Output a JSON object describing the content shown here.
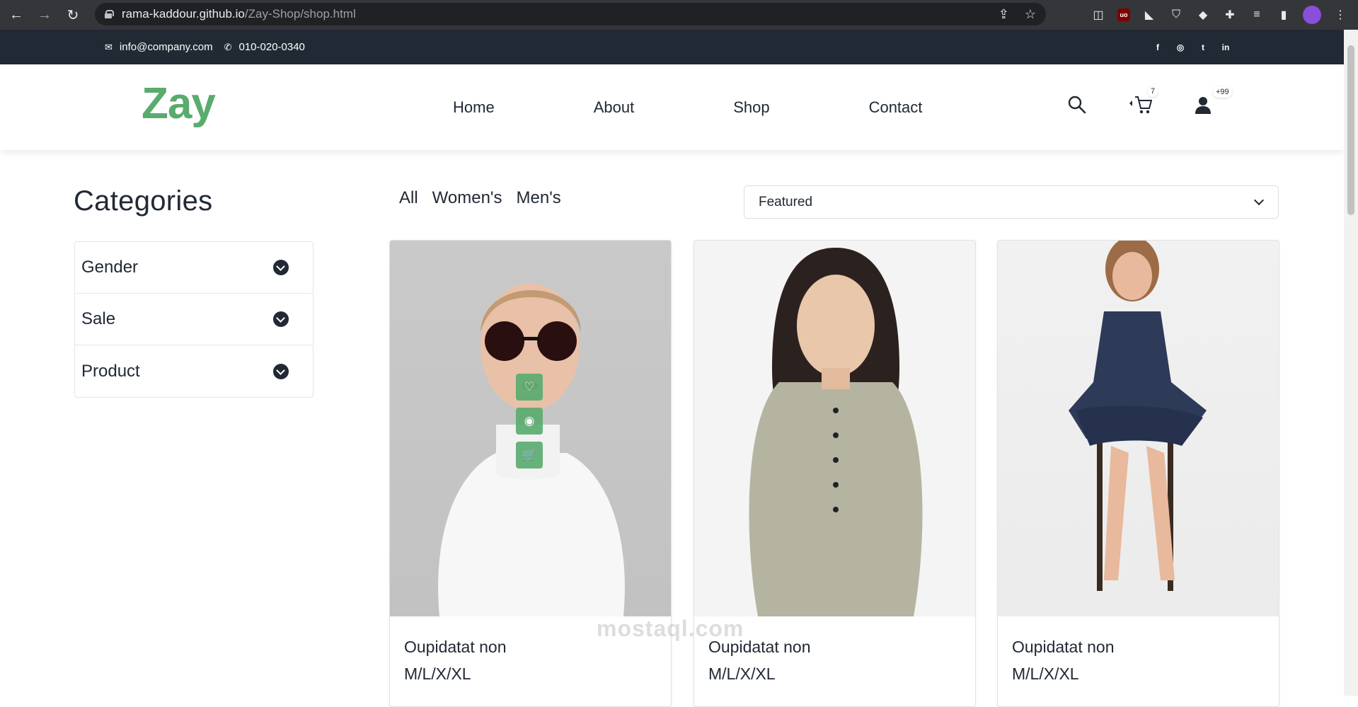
{
  "browser": {
    "url_host": "rama-kaddour.github.io",
    "url_path": "/Zay-Shop/shop.html"
  },
  "topbar": {
    "email": "info@company.com",
    "phone": "010-020-0340",
    "socials": [
      "f",
      "◎",
      "t",
      "in"
    ]
  },
  "header": {
    "logo": "Zay",
    "nav": [
      "Home",
      "About",
      "Shop",
      "Contact"
    ],
    "cart_count": "7",
    "user_count": "+99"
  },
  "sidebar": {
    "title": "Categories",
    "items": [
      {
        "label": "Gender"
      },
      {
        "label": "Sale"
      },
      {
        "label": "Product"
      }
    ]
  },
  "filters": {
    "tabs": [
      "All",
      "Women's",
      "Men's"
    ],
    "sort_selected": "Featured"
  },
  "products": [
    {
      "name": "Oupidatat non",
      "sizes": "M/L/X/XL"
    },
    {
      "name": "Oupidatat non",
      "sizes": "M/L/X/XL"
    },
    {
      "name": "Oupidatat non",
      "sizes": "M/L/X/XL"
    }
  ],
  "watermark": "mostaql.com",
  "colors": {
    "accent": "#59ab6e",
    "dark": "#212934"
  }
}
